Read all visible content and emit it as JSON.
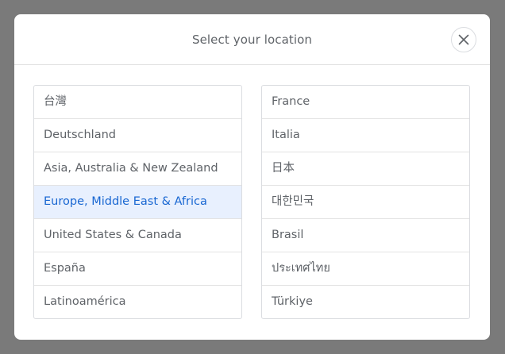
{
  "dialog": {
    "title": "Select your location",
    "close_icon": "close-icon"
  },
  "regions_left": [
    {
      "label": "台灣",
      "selected": false
    },
    {
      "label": "Deutschland",
      "selected": false
    },
    {
      "label": "Asia, Australia & New Zealand",
      "selected": false
    },
    {
      "label": "Europe, Middle East & Africa",
      "selected": true
    },
    {
      "label": "United States & Canada",
      "selected": false
    },
    {
      "label": "España",
      "selected": false
    },
    {
      "label": "Latinoamérica",
      "selected": false
    }
  ],
  "regions_right": [
    {
      "label": "France",
      "selected": false
    },
    {
      "label": "Italia",
      "selected": false
    },
    {
      "label": "日本",
      "selected": false
    },
    {
      "label": "대한민국",
      "selected": false
    },
    {
      "label": "Brasil",
      "selected": false
    },
    {
      "label": "ประเทศไทย",
      "selected": false
    },
    {
      "label": "Türkiye",
      "selected": false
    }
  ],
  "colors": {
    "overlay": "#7a7a7a",
    "selected_bg": "#e8f0fe",
    "selected_text": "#1967d2",
    "text": "#5f6368"
  }
}
